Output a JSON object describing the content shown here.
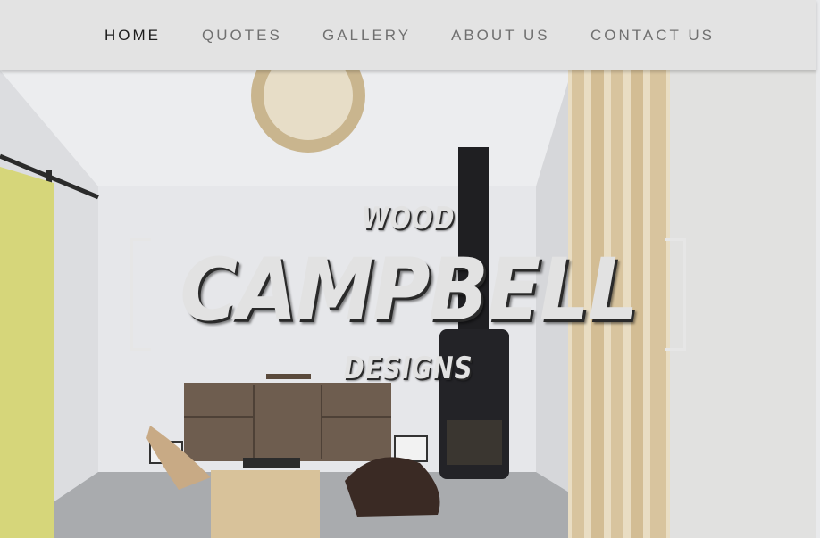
{
  "nav": {
    "items": [
      {
        "label": "HOME",
        "active": true
      },
      {
        "label": "QUOTES",
        "active": false
      },
      {
        "label": "GALLERY",
        "active": false
      },
      {
        "label": "ABOUT US",
        "active": false
      },
      {
        "label": "CONTACT US",
        "active": false
      }
    ]
  },
  "hero": {
    "brand_top": "WOOD",
    "brand_main": "CAMPBELL",
    "brand_bottom": "DESIGNS"
  },
  "colors": {
    "nav_background": "#e3e3e3",
    "nav_active": "#1d1d1d",
    "nav_inactive": "#707070",
    "brand_text": "#e2e2e2",
    "accent_door": "#d8d77a"
  }
}
